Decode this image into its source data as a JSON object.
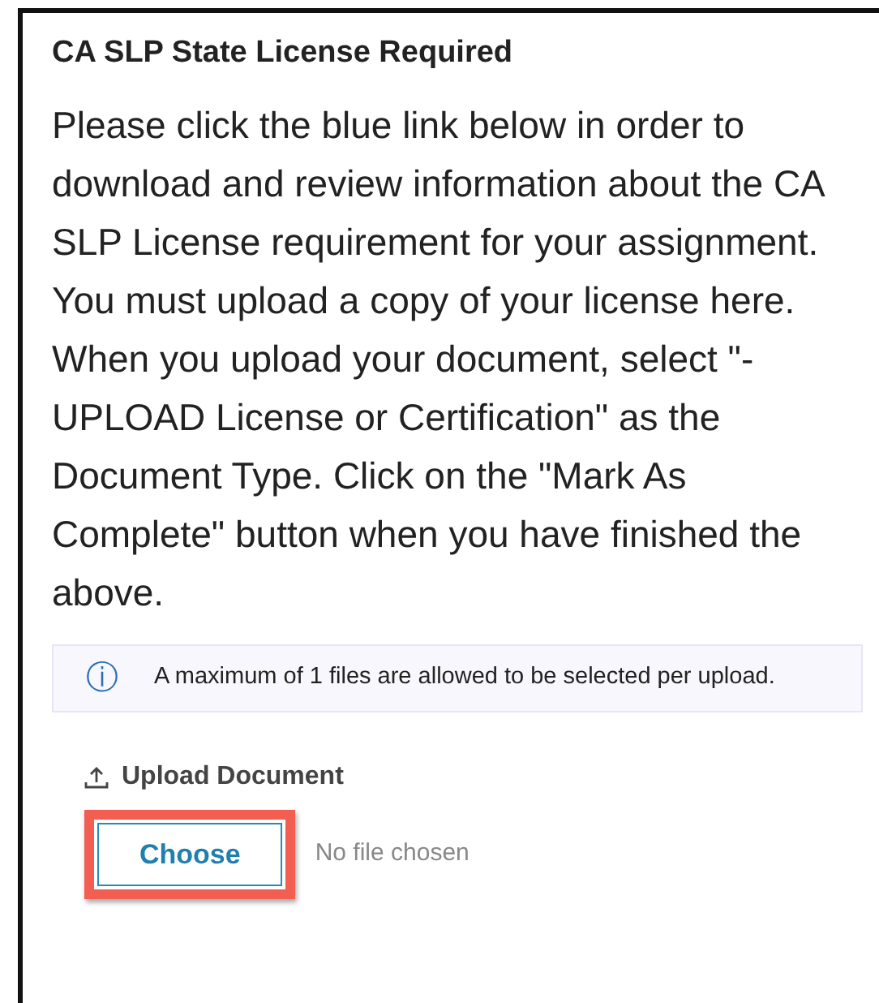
{
  "panel": {
    "title": "CA SLP State License Required",
    "instructions": "Please click the blue link below in order to download and review information about the CA SLP License requirement for your assignment. You must upload a copy of your license here. When you upload your document, select \"-UPLOAD License or Certification\" as the Document Type. Click on the \"Mark As Complete\" button when you have finished the above.",
    "notice": {
      "icon": "ⓘ",
      "text": "A maximum of 1 files are allowed to be selected per upload."
    },
    "upload": {
      "label": "Upload Document",
      "button": "Choose",
      "highlighted": true,
      "status": "No file chosen"
    }
  }
}
